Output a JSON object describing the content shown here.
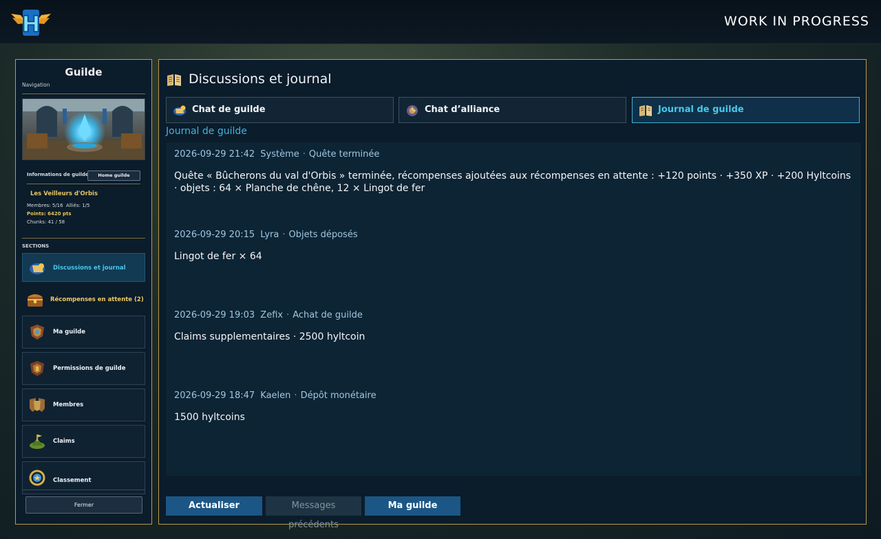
{
  "header": {
    "logo_letter": "H",
    "status_text": "WORK IN PROGRESS"
  },
  "sidebar": {
    "title": "Guilde",
    "subtitle": "Navigation",
    "info_label": "Informations de guilde",
    "home_button": "Home guilde",
    "guild_name": "Les Veilleurs d'Orbis",
    "members": "Membres: 5/16",
    "allies": "Alliés: 1/5",
    "points": "Points: 6420 pts",
    "chunks": "Chunks: 41 / 58",
    "sections_label": "SECTIONS",
    "items": [
      {
        "label": "Discussions et journal",
        "icon": "scroll-chat-icon",
        "active": true
      },
      {
        "label": "Récompenses en attente (2)",
        "icon": "treasure-chest-icon",
        "gold": true
      },
      {
        "label": "Ma guilde",
        "icon": "guild-crest-icon"
      },
      {
        "label": "Permissions de guilde",
        "icon": "permissions-crest-icon"
      },
      {
        "label": "Membres",
        "icon": "members-shield-icon"
      },
      {
        "label": "Claims",
        "icon": "land-claim-icon"
      },
      {
        "label": "Classement",
        "icon": "laurel-ranking-icon"
      }
    ],
    "close_button": "Fermer"
  },
  "main": {
    "title": "Discussions et journal",
    "tabs": [
      {
        "label": "Chat de guilde",
        "icon": "guild-chat-icon",
        "active": false
      },
      {
        "label": "Chat d’alliance",
        "icon": "alliance-chat-icon",
        "active": false
      },
      {
        "label": "Journal de guilde",
        "icon": "journal-book-icon",
        "active": true
      }
    ],
    "section_label": "Journal de guilde",
    "entries": [
      {
        "datetime": "2026-09-29 21:42",
        "author": "Système",
        "type": "Quête terminée",
        "message": "Quête « Bûcherons du val d'Orbis » terminée, récompenses ajoutées aux récompenses en attente : +120 points · +350 XP · +200 Hyltcoins · objets : 64 × Planche de chêne, 12 × Lingot de fer"
      },
      {
        "datetime": "2026-09-29 20:15",
        "author": "Lyra",
        "type": "Objets déposés",
        "message": "Lingot de fer × 64"
      },
      {
        "datetime": "2026-09-29 19:03",
        "author": "Zefix",
        "type": "Achat de guilde",
        "message": "Claims supplementaires · 2500 hyltcoin"
      },
      {
        "datetime": "2026-09-29 18:47",
        "author": "Kaelen",
        "type": "Dépôt monétaire",
        "message": "1500 hyltcoins"
      }
    ],
    "separator": "·",
    "buttons": {
      "refresh": "Actualiser",
      "previous": "Messages précédents",
      "my_guild": "Ma guilde"
    }
  },
  "colors": {
    "accent": "#3fb4dc",
    "gold_border": "#b99a4c",
    "panel": "#0b1c2b",
    "primary_button": "#1b5686"
  }
}
